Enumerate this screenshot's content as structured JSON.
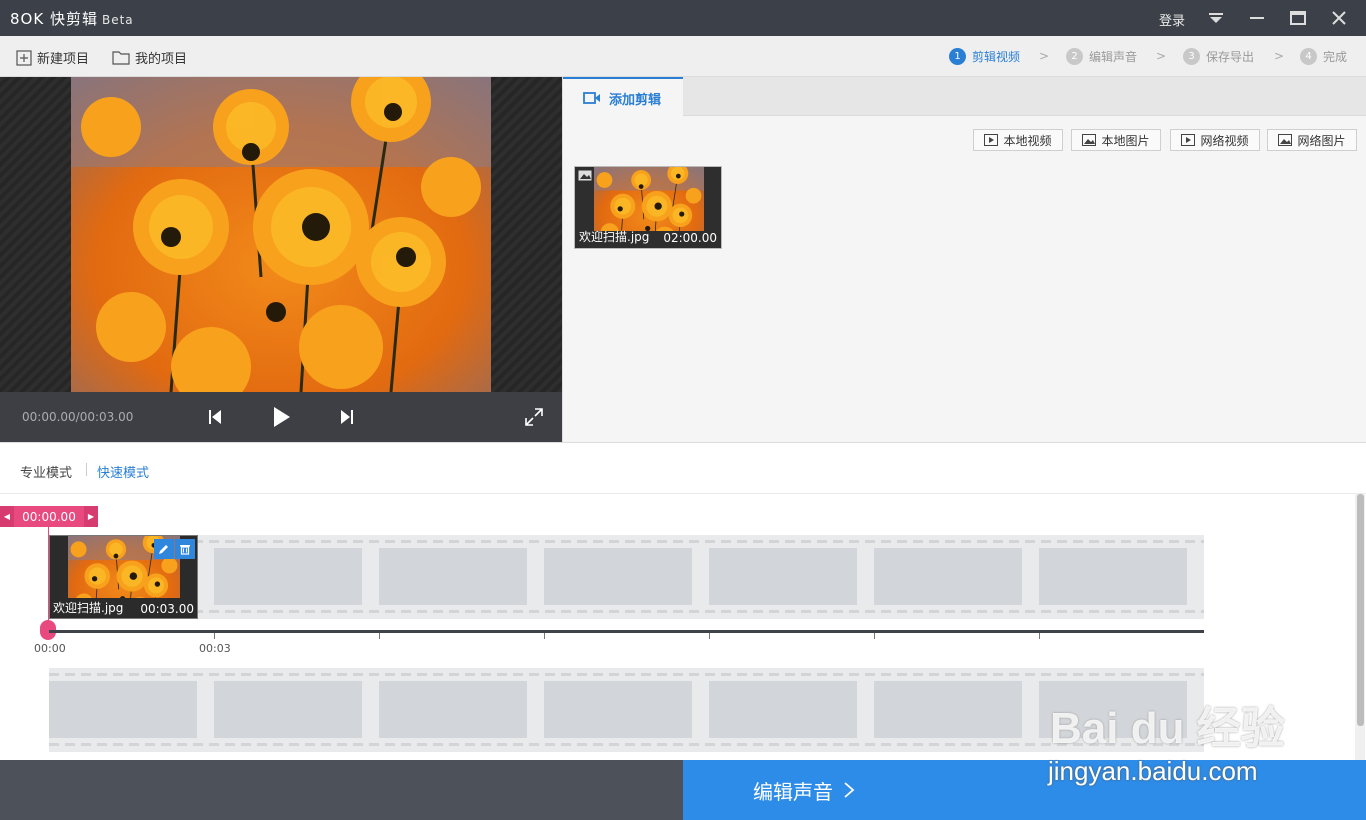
{
  "app": {
    "logo_text": "8OK 快剪辑",
    "beta": "Beta",
    "login": "登录"
  },
  "toolbar": {
    "new_project": "新建项目",
    "my_projects": "我的项目"
  },
  "steps": [
    {
      "num": "1",
      "label": "剪辑视频",
      "active": true
    },
    {
      "num": "2",
      "label": "编辑声音",
      "active": false
    },
    {
      "num": "3",
      "label": "保存导出",
      "active": false
    },
    {
      "num": "4",
      "label": "完成",
      "active": false
    }
  ],
  "player": {
    "time": "00:00.00/00:03.00"
  },
  "right_panel": {
    "tab_label": "添加剪辑",
    "sources": [
      "本地视频",
      "本地图片",
      "网络视频",
      "网络图片"
    ],
    "media": {
      "filename": "欢迎扫描.jpg",
      "duration": "02:00.00"
    }
  },
  "modes": {
    "pro": "专业模式",
    "quick": "快速模式"
  },
  "timeline": {
    "playhead_time": "00:00.00",
    "clip": {
      "filename": "欢迎扫描.jpg",
      "duration": "00:03.00"
    },
    "tick_labels": [
      "00:00",
      "00:03"
    ]
  },
  "footer": {
    "next_label": "编辑声音"
  },
  "watermark": {
    "brand": "Bai du 经验",
    "url": "jingyan.baidu.com"
  },
  "colors": {
    "accent": "#2a7fd4",
    "playhead": "#e84a7f",
    "next_button": "#2d8ce8"
  }
}
